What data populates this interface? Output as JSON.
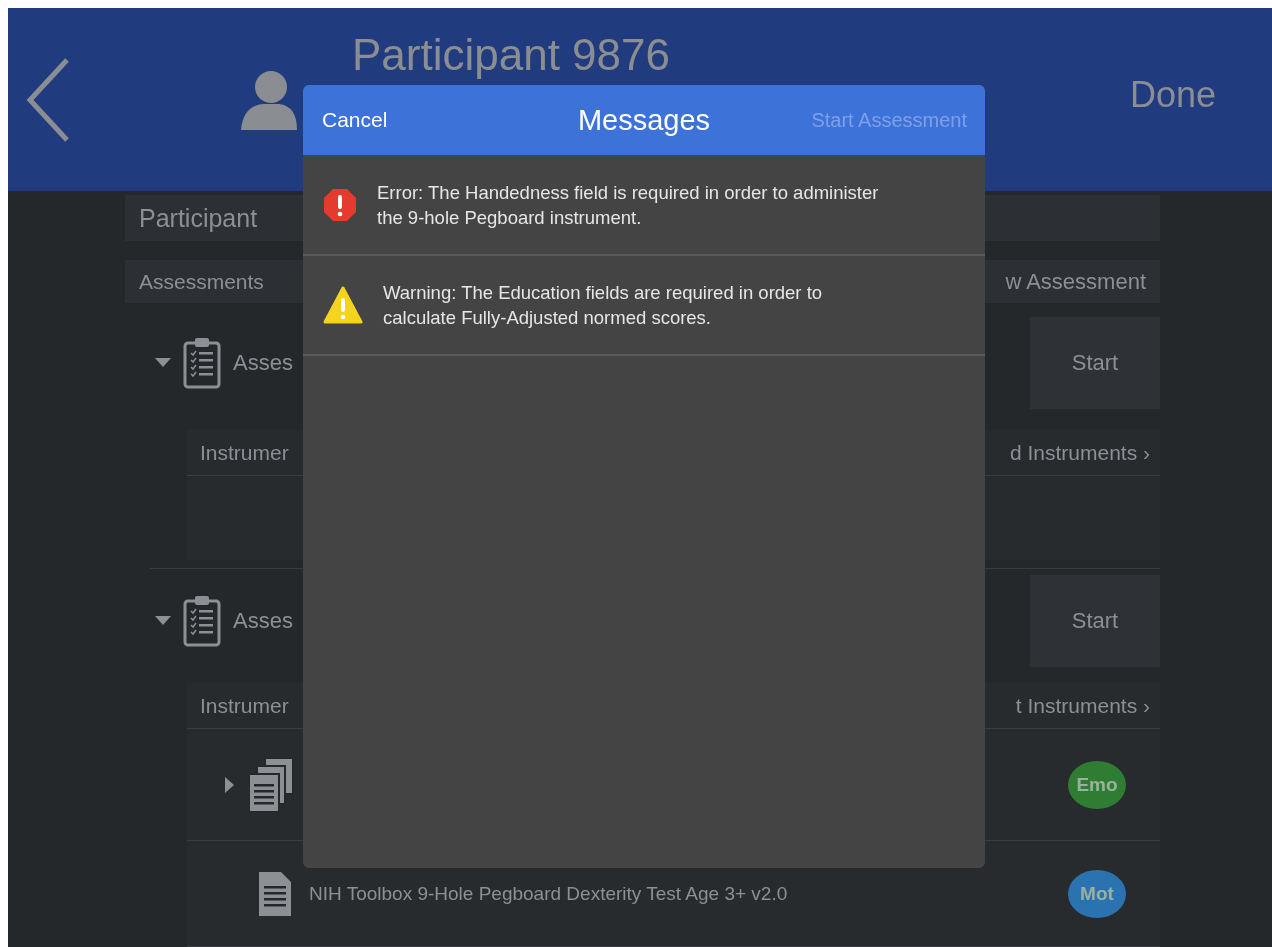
{
  "header": {
    "title": "Participant 9876",
    "done": "Done"
  },
  "participant_section": {
    "label": "Participant"
  },
  "assessments_section": {
    "label": "Assessments",
    "action": "w Assessment"
  },
  "assessments": [
    {
      "label": "Asses",
      "expanded": true,
      "start": "Start",
      "instruments_label": "Instrumer",
      "instruments_action": "d Instruments ›"
    },
    {
      "label": "Asses",
      "expanded": true,
      "start": "Start",
      "instruments_label": "Instrumer",
      "instruments_action": "t Instruments ›",
      "instruments": [
        {
          "kind": "group",
          "expanded": false,
          "badge": "Emo",
          "color": "#2e7d32"
        },
        {
          "kind": "single",
          "name": "NIH Toolbox 9-Hole Pegboard Dexterity Test Age 3+ v2.0",
          "badge": "Mot",
          "color": "#2a72b0"
        }
      ]
    }
  ],
  "dialog": {
    "title": "Messages",
    "cancel": "Cancel",
    "confirm": {
      "label": "Start Assessment",
      "disabled": true
    },
    "messages": [
      {
        "kind": "error",
        "text": "Error: The Handedness field is required in order to administer the 9-hole Pegboard instrument."
      },
      {
        "kind": "warning",
        "text": "Warning: The Education fields are required in order to calculate Fully-Adjusted normed scores."
      }
    ]
  }
}
